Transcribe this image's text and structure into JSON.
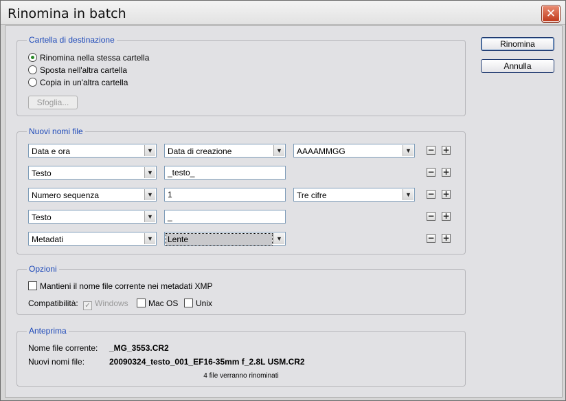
{
  "window": {
    "title": "Rinomina in batch",
    "close_icon": "close-icon"
  },
  "buttons": {
    "rename": "Rinomina",
    "cancel": "Annulla"
  },
  "destination": {
    "title": "Cartella di destinazione",
    "options": [
      "Rinomina nella stessa cartella",
      "Sposta nell'altra cartella",
      "Copia in un'altra cartella"
    ],
    "selected": 0,
    "browse": "Sfoglia..."
  },
  "new_names": {
    "title": "Nuovi nomi file",
    "rows": [
      {
        "type": "Data e ora",
        "field2": "Data di creazione",
        "field3": "AAAAMMGG"
      },
      {
        "type": "Testo",
        "field2": "_testo_"
      },
      {
        "type": "Numero sequenza",
        "field2": "1",
        "field3": "Tre cifre"
      },
      {
        "type": "Testo",
        "field2": "_"
      },
      {
        "type": "Metadati",
        "field2": "Lente"
      }
    ],
    "minus": "−",
    "plus": "+"
  },
  "options": {
    "title": "Opzioni",
    "keep_name": "Mantieni il nome file corrente nei metadati XMP",
    "keep_name_checked": false,
    "compat_label": "Compatibilità:",
    "windows": "Windows",
    "windows_checked": true,
    "macos": "Mac OS",
    "macos_checked": false,
    "unix": "Unix",
    "unix_checked": false
  },
  "preview": {
    "title": "Anteprima",
    "current_label": "Nome file corrente:",
    "current_value": "_MG_3553.CR2",
    "new_label": "Nuovi nomi file:",
    "new_value": "20090324_testo_001_EF16-35mm f_2.8L USM.CR2",
    "count": "4 file verranno rinominati"
  }
}
